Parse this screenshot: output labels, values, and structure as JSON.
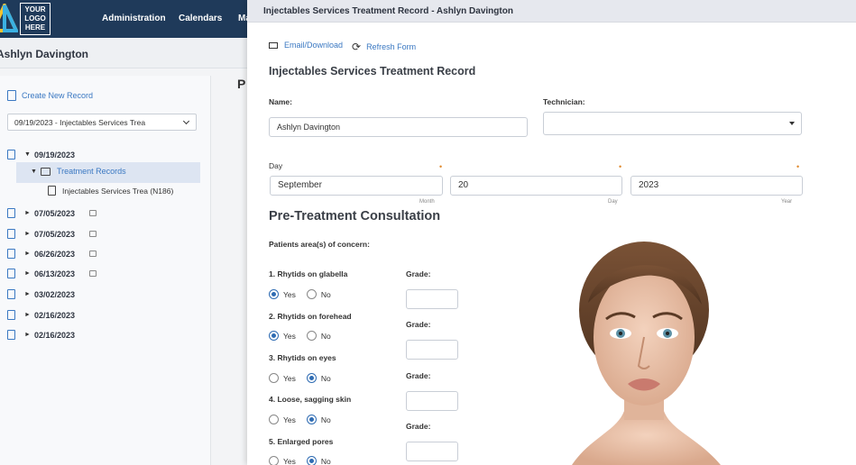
{
  "app": {
    "logo": [
      "YOUR",
      "LOGO",
      "HERE"
    ],
    "nav": [
      "Administration",
      "Calendars",
      "Ma"
    ]
  },
  "patient": {
    "name": "Ashlyn Davington"
  },
  "sidebar": {
    "create_label": "Create New Record",
    "selected_record": "09/19/2023 - Injectables Services Trea",
    "p_letter": "P",
    "tree": {
      "root_date": "09/19/2023",
      "folder": "Treatment Records",
      "file": "Injectables Services Trea (N186)",
      "other_dates": [
        "07/05/2023",
        "07/05/2023",
        "06/26/2023",
        "06/13/2023",
        "03/02/2023",
        "02/16/2023",
        "02/16/2023"
      ]
    }
  },
  "modal": {
    "title": "Injectables Services Treatment Record - Ashlyn Davington",
    "email_label": "Email/Download",
    "refresh_label": "Refresh Form",
    "heading": "Injectables Services Treatment Record",
    "name_label": "Name:",
    "name_value": "Ashlyn Davington",
    "technician_label": "Technician:",
    "technician_value": "",
    "day_label": "Day",
    "month_value": "September",
    "day_value": "20",
    "year_value": "2023",
    "month_sub": "Month",
    "day_sub": "Day",
    "year_sub": "Year",
    "section_heading": "Pre-Treatment Consultation",
    "concern_label": "Patients area(s) of concern:",
    "grade_label": "Grade:",
    "yes_label": "Yes",
    "no_label": "No",
    "questions": [
      {
        "label": "1. Rhytids on glabella",
        "selected": "yes"
      },
      {
        "label": "2. Rhytids on forehead",
        "selected": "yes"
      },
      {
        "label": "3. Rhytids on eyes",
        "selected": "no"
      },
      {
        "label": "4. Loose, sagging skin",
        "selected": "no"
      },
      {
        "label": "5. Enlarged pores",
        "selected": "no"
      }
    ]
  },
  "colors": {
    "nav_bg": "#1f3a5a",
    "accent": "#3a78c2",
    "required": "#e08a2e",
    "radio": "#2f6cb3"
  }
}
